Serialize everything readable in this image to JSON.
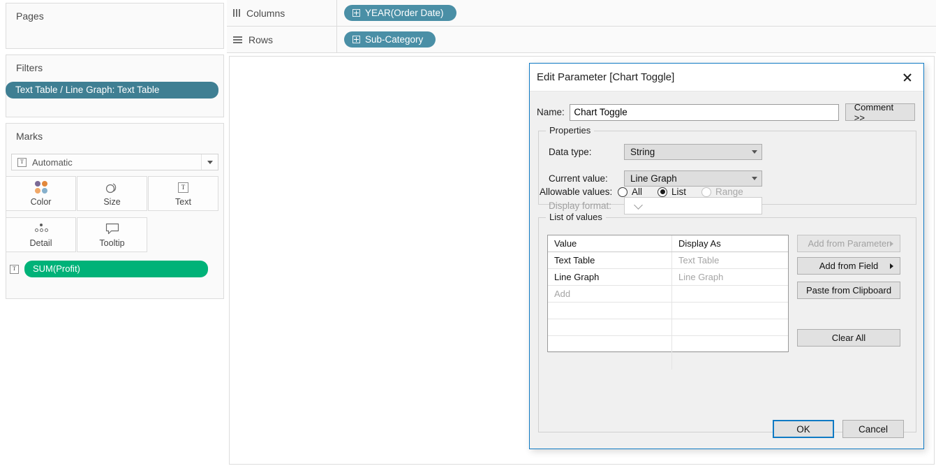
{
  "left_pane": {
    "pages": {
      "title": "Pages"
    },
    "filters": {
      "title": "Filters",
      "pill": "Text Table / Line Graph: Text Table"
    },
    "marks": {
      "title": "Marks",
      "mark_type": "Automatic",
      "mark_type_icon": "text-badge-icon",
      "buttons": [
        {
          "label": "Color",
          "icon": "color-dots-icon"
        },
        {
          "label": "Size",
          "icon": "size-circles-icon"
        },
        {
          "label": "Text",
          "icon": "text-badge-icon"
        },
        {
          "label": "Detail",
          "icon": "detail-dots-icon"
        },
        {
          "label": "Tooltip",
          "icon": "tooltip-bubble-icon"
        }
      ],
      "field_pill": "SUM(Profit)",
      "field_pill_icon": "text-badge-icon"
    }
  },
  "shelves": {
    "columns": {
      "label": "Columns",
      "icon": "columns-icon",
      "pill": "YEAR(Order Date)"
    },
    "rows": {
      "label": "Rows",
      "icon": "rows-icon",
      "pill": "Sub-Category"
    }
  },
  "dialog": {
    "title": "Edit Parameter [Chart Toggle]",
    "close_icon": "close-icon",
    "name_label": "Name:",
    "name_value": "Chart Toggle",
    "comment_button": "Comment >>",
    "properties": {
      "legend": "Properties",
      "data_type_label": "Data type:",
      "data_type_value": "String",
      "current_value_label": "Current value:",
      "current_value_value": "Line Graph",
      "display_format_label": "Display format:",
      "display_format_value": "",
      "allowable_label": "Allowable values:",
      "allowable_options": [
        {
          "label": "All",
          "checked": false,
          "disabled": false
        },
        {
          "label": "List",
          "checked": true,
          "disabled": false
        },
        {
          "label": "Range",
          "checked": false,
          "disabled": true
        }
      ]
    },
    "list_of_values": {
      "legend": "List of values",
      "headers": [
        "Value",
        "Display As"
      ],
      "rows": [
        {
          "value": "Text Table",
          "display_as": "Text Table"
        },
        {
          "value": "Line Graph",
          "display_as": "Line Graph"
        },
        {
          "value": "Add",
          "display_as": ""
        },
        {
          "value": "",
          "display_as": ""
        },
        {
          "value": "",
          "display_as": ""
        },
        {
          "value": "",
          "display_as": ""
        },
        {
          "value": "",
          "display_as": ""
        }
      ],
      "buttons": [
        {
          "label": "Add from Parameter",
          "disabled": true,
          "has_arrow": true
        },
        {
          "label": "Add from Field",
          "disabled": false,
          "has_arrow": true
        },
        {
          "label": "Paste from Clipboard",
          "disabled": false,
          "has_arrow": false
        },
        {
          "label": "Clear All",
          "disabled": false,
          "has_arrow": false
        }
      ]
    },
    "footer": {
      "ok": "OK",
      "cancel": "Cancel"
    }
  },
  "colors": {
    "pill_blue": "#4a8fa6",
    "filter_blue": "#3f7f93",
    "measure_green": "#00b278",
    "accent_border": "#0f7ac4",
    "mark_dot_purple": "#7b6a96",
    "mark_dot_orange": "#e2883c",
    "mark_dot_lightorange": "#f0a868",
    "mark_dot_blue": "#86b0cc"
  }
}
